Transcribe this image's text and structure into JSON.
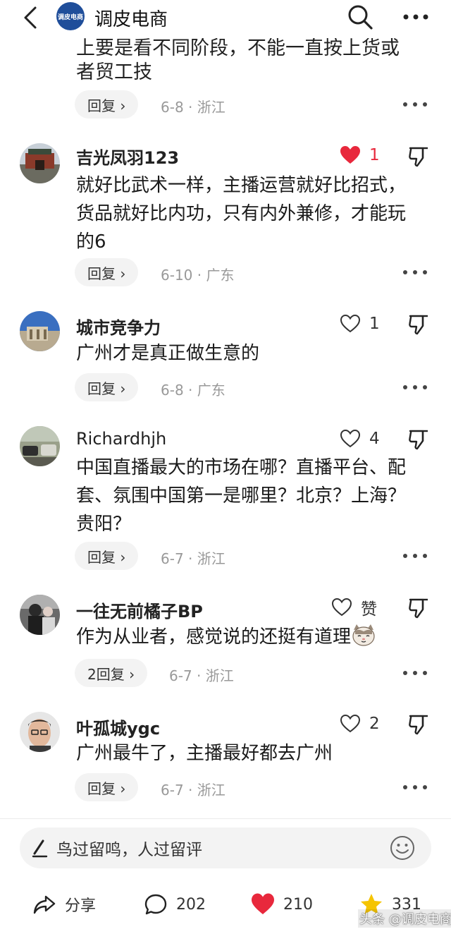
{
  "header": {
    "title": "调皮电商",
    "logo_text": "调皮电商"
  },
  "top_partial": {
    "line1": "上要是看不同阶段，不能一直按上货或",
    "line2": "者贸工技",
    "reply_label": "回复 ›",
    "meta": "6-8 · 浙江"
  },
  "comments": [
    {
      "name": "吉光凤羽123",
      "text": "就好比武术一样，主播运营就好比招式，货品就好比内功，只有内外兼修，才能玩的6",
      "likes": "1",
      "liked": true,
      "reply_label": "回复 ›",
      "meta": "6-10 · 广东"
    },
    {
      "name": "城市竞争力",
      "text": "广州才是真正做生意的",
      "likes": "1",
      "liked": false,
      "reply_label": "回复 ›",
      "meta": "6-8 · 广东"
    },
    {
      "name": "Richardhjh",
      "text": "中国直播最大的市场在哪？直播平台、配套、氛围中国第一是哪里？北京？上海？贵阳？",
      "likes": "4",
      "liked": false,
      "reply_label": "回复 ›",
      "meta": "6-7 · 浙江"
    },
    {
      "name": "一往无前橘子BP",
      "text": "作为从业者，感觉说的还挺有道理",
      "likes": "赞",
      "liked": false,
      "reply_label": "2回复 ›",
      "meta": "6-7 · 浙江"
    },
    {
      "name": "叶孤城ygc",
      "text": "广州最牛了，主播最好都去广州",
      "likes": "2",
      "liked": false,
      "reply_label": "回复 ›",
      "meta": "6-7 · 浙江"
    }
  ],
  "composer": {
    "placeholder": "鸟过留鸣，人过留评"
  },
  "actions": {
    "share": "分享",
    "comments": "202",
    "likes": "210",
    "favorites": "331"
  },
  "watermark": "头条 @调皮电商",
  "colors": {
    "like_red": "#e8283c",
    "star_yellow": "#f5c400",
    "reply_bg": "#f3f3f3",
    "meta_gray": "#999999"
  }
}
